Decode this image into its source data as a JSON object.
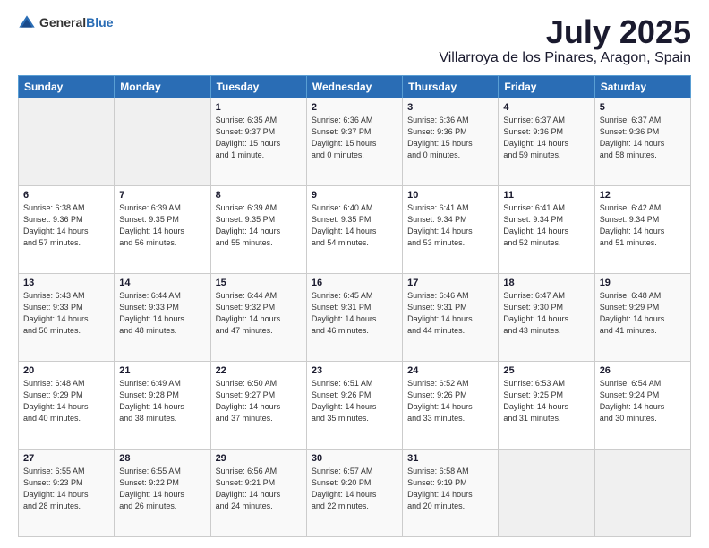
{
  "header": {
    "logo_general": "General",
    "logo_blue": "Blue",
    "month": "July 2025",
    "location": "Villarroya de los Pinares, Aragon, Spain"
  },
  "weekdays": [
    "Sunday",
    "Monday",
    "Tuesday",
    "Wednesday",
    "Thursday",
    "Friday",
    "Saturday"
  ],
  "weeks": [
    [
      {
        "day": "",
        "info": ""
      },
      {
        "day": "",
        "info": ""
      },
      {
        "day": "1",
        "info": "Sunrise: 6:35 AM\nSunset: 9:37 PM\nDaylight: 15 hours\nand 1 minute."
      },
      {
        "day": "2",
        "info": "Sunrise: 6:36 AM\nSunset: 9:37 PM\nDaylight: 15 hours\nand 0 minutes."
      },
      {
        "day": "3",
        "info": "Sunrise: 6:36 AM\nSunset: 9:36 PM\nDaylight: 15 hours\nand 0 minutes."
      },
      {
        "day": "4",
        "info": "Sunrise: 6:37 AM\nSunset: 9:36 PM\nDaylight: 14 hours\nand 59 minutes."
      },
      {
        "day": "5",
        "info": "Sunrise: 6:37 AM\nSunset: 9:36 PM\nDaylight: 14 hours\nand 58 minutes."
      }
    ],
    [
      {
        "day": "6",
        "info": "Sunrise: 6:38 AM\nSunset: 9:36 PM\nDaylight: 14 hours\nand 57 minutes."
      },
      {
        "day": "7",
        "info": "Sunrise: 6:39 AM\nSunset: 9:35 PM\nDaylight: 14 hours\nand 56 minutes."
      },
      {
        "day": "8",
        "info": "Sunrise: 6:39 AM\nSunset: 9:35 PM\nDaylight: 14 hours\nand 55 minutes."
      },
      {
        "day": "9",
        "info": "Sunrise: 6:40 AM\nSunset: 9:35 PM\nDaylight: 14 hours\nand 54 minutes."
      },
      {
        "day": "10",
        "info": "Sunrise: 6:41 AM\nSunset: 9:34 PM\nDaylight: 14 hours\nand 53 minutes."
      },
      {
        "day": "11",
        "info": "Sunrise: 6:41 AM\nSunset: 9:34 PM\nDaylight: 14 hours\nand 52 minutes."
      },
      {
        "day": "12",
        "info": "Sunrise: 6:42 AM\nSunset: 9:34 PM\nDaylight: 14 hours\nand 51 minutes."
      }
    ],
    [
      {
        "day": "13",
        "info": "Sunrise: 6:43 AM\nSunset: 9:33 PM\nDaylight: 14 hours\nand 50 minutes."
      },
      {
        "day": "14",
        "info": "Sunrise: 6:44 AM\nSunset: 9:33 PM\nDaylight: 14 hours\nand 48 minutes."
      },
      {
        "day": "15",
        "info": "Sunrise: 6:44 AM\nSunset: 9:32 PM\nDaylight: 14 hours\nand 47 minutes."
      },
      {
        "day": "16",
        "info": "Sunrise: 6:45 AM\nSunset: 9:31 PM\nDaylight: 14 hours\nand 46 minutes."
      },
      {
        "day": "17",
        "info": "Sunrise: 6:46 AM\nSunset: 9:31 PM\nDaylight: 14 hours\nand 44 minutes."
      },
      {
        "day": "18",
        "info": "Sunrise: 6:47 AM\nSunset: 9:30 PM\nDaylight: 14 hours\nand 43 minutes."
      },
      {
        "day": "19",
        "info": "Sunrise: 6:48 AM\nSunset: 9:29 PM\nDaylight: 14 hours\nand 41 minutes."
      }
    ],
    [
      {
        "day": "20",
        "info": "Sunrise: 6:48 AM\nSunset: 9:29 PM\nDaylight: 14 hours\nand 40 minutes."
      },
      {
        "day": "21",
        "info": "Sunrise: 6:49 AM\nSunset: 9:28 PM\nDaylight: 14 hours\nand 38 minutes."
      },
      {
        "day": "22",
        "info": "Sunrise: 6:50 AM\nSunset: 9:27 PM\nDaylight: 14 hours\nand 37 minutes."
      },
      {
        "day": "23",
        "info": "Sunrise: 6:51 AM\nSunset: 9:26 PM\nDaylight: 14 hours\nand 35 minutes."
      },
      {
        "day": "24",
        "info": "Sunrise: 6:52 AM\nSunset: 9:26 PM\nDaylight: 14 hours\nand 33 minutes."
      },
      {
        "day": "25",
        "info": "Sunrise: 6:53 AM\nSunset: 9:25 PM\nDaylight: 14 hours\nand 31 minutes."
      },
      {
        "day": "26",
        "info": "Sunrise: 6:54 AM\nSunset: 9:24 PM\nDaylight: 14 hours\nand 30 minutes."
      }
    ],
    [
      {
        "day": "27",
        "info": "Sunrise: 6:55 AM\nSunset: 9:23 PM\nDaylight: 14 hours\nand 28 minutes."
      },
      {
        "day": "28",
        "info": "Sunrise: 6:55 AM\nSunset: 9:22 PM\nDaylight: 14 hours\nand 26 minutes."
      },
      {
        "day": "29",
        "info": "Sunrise: 6:56 AM\nSunset: 9:21 PM\nDaylight: 14 hours\nand 24 minutes."
      },
      {
        "day": "30",
        "info": "Sunrise: 6:57 AM\nSunset: 9:20 PM\nDaylight: 14 hours\nand 22 minutes."
      },
      {
        "day": "31",
        "info": "Sunrise: 6:58 AM\nSunset: 9:19 PM\nDaylight: 14 hours\nand 20 minutes."
      },
      {
        "day": "",
        "info": ""
      },
      {
        "day": "",
        "info": ""
      }
    ]
  ]
}
